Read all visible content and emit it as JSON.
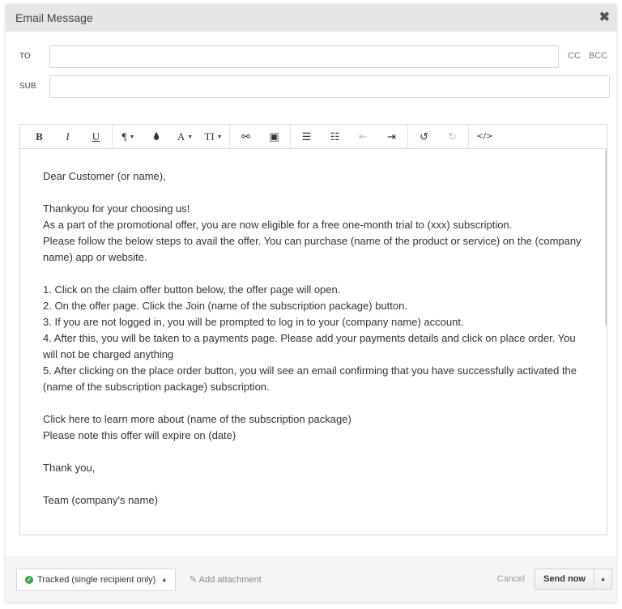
{
  "dialog": {
    "title": "Email Message",
    "close_icon": "close-icon"
  },
  "recipients": {
    "to_label": "TO",
    "to_value": "",
    "cc_label": "CC",
    "bcc_label": "BCC",
    "subject_label": "SUB",
    "subject_value": ""
  },
  "toolbar": {
    "groups": [
      [
        {
          "name": "bold",
          "glyph": "B"
        },
        {
          "name": "italic",
          "glyph": "I"
        },
        {
          "name": "underline",
          "glyph": "U"
        }
      ],
      [
        {
          "name": "paragraph",
          "glyph": "¶",
          "dropdown": true
        },
        {
          "name": "color",
          "glyph": "💧"
        },
        {
          "name": "font",
          "glyph": "A",
          "dropdown": true
        },
        {
          "name": "font-size",
          "glyph": "TI",
          "dropdown": true
        }
      ],
      [
        {
          "name": "link",
          "glyph": "⚯"
        },
        {
          "name": "image",
          "glyph": "▣"
        }
      ],
      [
        {
          "name": "ordered-list",
          "glyph": "☰"
        },
        {
          "name": "unordered-list",
          "glyph": "☷"
        },
        {
          "name": "outdent",
          "glyph": "⇤",
          "disabled": true
        },
        {
          "name": "indent",
          "glyph": "⇥"
        }
      ],
      [
        {
          "name": "undo",
          "glyph": "↺"
        },
        {
          "name": "redo",
          "glyph": "↻",
          "disabled": true
        }
      ],
      [
        {
          "name": "code-view",
          "glyph": "</>"
        }
      ]
    ]
  },
  "body": {
    "lines": [
      "Dear Customer (or name),",
      "",
      "Thankyou for your choosing us!",
      "As a part of the promotional offer, you are now eligible for a free one-month trial to (xxx) subscription.",
      "Please follow the below steps to avail the offer. You can purchase (name of the product or service) on the (company name) app or website.",
      "",
      "1. Click on the claim offer button below, the offer page will open.",
      "2. On the offer page. Click the Join (name of the subscription package) button.",
      "3. If you are not logged in, you will be prompted to log in to your (company name) account.",
      "4. After this, you will be taken to a payments page. Please add your payments details and click on place order. You will not be charged anything",
      "5. After clicking on the place order button, you will see an email confirming that you have successfully activated the (name of the subscription package) subscription.",
      "",
      "Click here to learn more about (name of the subscription package)",
      "Please note this offer will expire on (date)",
      "",
      "Thank you,",
      "",
      "Team (company's name)"
    ]
  },
  "footer": {
    "tracking_label": "Tracked (single recipient only)",
    "tracking_color": "#2eaa4a",
    "attachment_label": "Add attachment",
    "cancel_label": "Cancel",
    "send_label": "Send now"
  }
}
